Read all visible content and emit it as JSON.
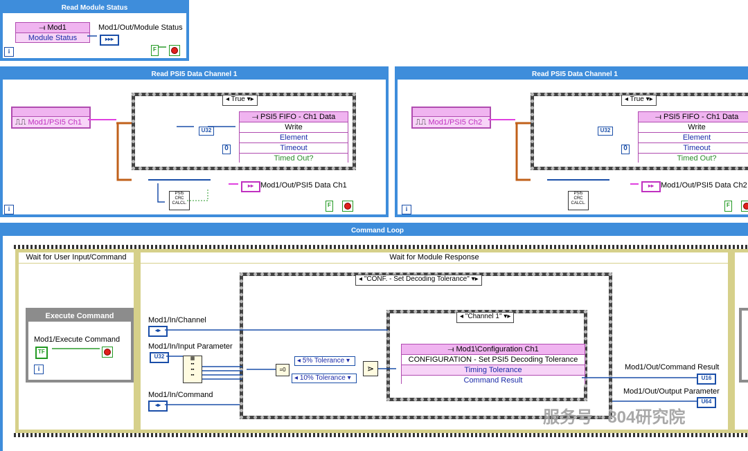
{
  "read_status": {
    "title": "Read Module Status",
    "node_name": "Mod1",
    "node_prop": "Module Status",
    "out_label": "Mod1/Out/Module Status",
    "stop_bool": "F"
  },
  "psi5_ch1": {
    "title": "Read PSI5 Data Channel 1",
    "in_label": "Mod1/PSI5 Ch1",
    "case_label": "True",
    "fifo_title": "PSI5 FIFO - Ch1 Data",
    "fifo_rows": [
      "Write",
      "Element",
      "Timeout",
      "Timed Out?"
    ],
    "u32_label": "U32",
    "zero": "0",
    "crc_label": [
      "PSI5",
      "CRC",
      "CALCL."
    ],
    "out_label": "Mod1/Out/PSI5 Data Ch1",
    "stop_bool": "F"
  },
  "psi5_ch2": {
    "title": "Read PSI5 Data Channel 1",
    "in_label": "Mod1/PSI5 Ch2",
    "case_label": "True",
    "fifo_title": "PSI5 FIFO - Ch1 Data",
    "fifo_rows": [
      "Write",
      "Element",
      "Timeout",
      "Timed Out?"
    ],
    "u32_label": "U32",
    "zero": "0",
    "crc_label": [
      "PSI5",
      "CRC",
      "CALCL."
    ],
    "out_label": "Mod1/Out/PSI5 Data Ch2",
    "stop_bool": "F"
  },
  "command_loop": {
    "title": "Command Loop",
    "frame1_title": "Wait for User Input/Command",
    "frame2_title": "Wait for Module Response",
    "exec_title": "Execute Command",
    "exec_label": "Mod1/Execute Command",
    "in_channel": "Mod1/In/Channel",
    "in_param": "Mod1/In/Input Parameter",
    "in_command": "Mod1/In/Command",
    "outer_case": "\"CONF. - Set Decoding Tolerance\"",
    "inner_case": "\"Channel 1\"",
    "tol1": "5% Tolerance",
    "tol2": "10% Tolerance",
    "node_title": "Mod1\\Configuration Ch1",
    "node_rows": [
      "CONFIGURATION - Set PSI5 Decoding Tolerance",
      "Timing Tolerance",
      "Command Result"
    ],
    "out_result": "Mod1/Out/Command Result",
    "out_param": "Mod1/Out/Output Parameter",
    "u16": "U16",
    "u64": "U64",
    "u32": "U32"
  },
  "watermark": "服务号 · 804研究院",
  "colors": {
    "loop_blue": "#3e8ddb",
    "node_pink": "#f7d4f7",
    "wire_blue": "#1a4ea8",
    "wire_orange": "#c0601a",
    "wire_pink": "#e040e0",
    "wire_green": "#2a9a2a"
  }
}
